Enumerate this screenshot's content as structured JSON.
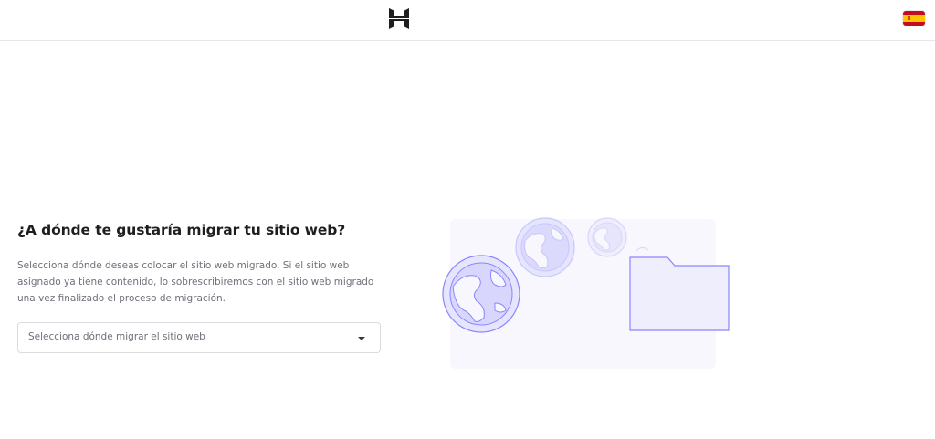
{
  "header": {
    "logo_icon": "hostinger-logo-icon",
    "language_icon": "spain-flag-icon",
    "flag_colors": {
      "red": "#c60b1e",
      "yellow": "#ffc400"
    }
  },
  "main": {
    "title": "¿A dónde te gustaría migrar tu sitio web?",
    "description": "Selecciona dónde deseas colocar el sitio web migrado. Si el sitio web asignado ya tiene contenido, lo sobrescribiremos con el sitio web migrado una vez finalizado el proceso de migración.",
    "select": {
      "placeholder": "Selecciona dónde migrar el sitio web",
      "caret_icon": "caret-down-icon"
    }
  },
  "illustration": {
    "icons": [
      "globe-icon",
      "globe-icon",
      "globe-icon",
      "folder-icon"
    ],
    "colors": {
      "panel": "#f7f7fd",
      "fill": "#e5e5fd",
      "stroke": "#8c85ff"
    }
  }
}
